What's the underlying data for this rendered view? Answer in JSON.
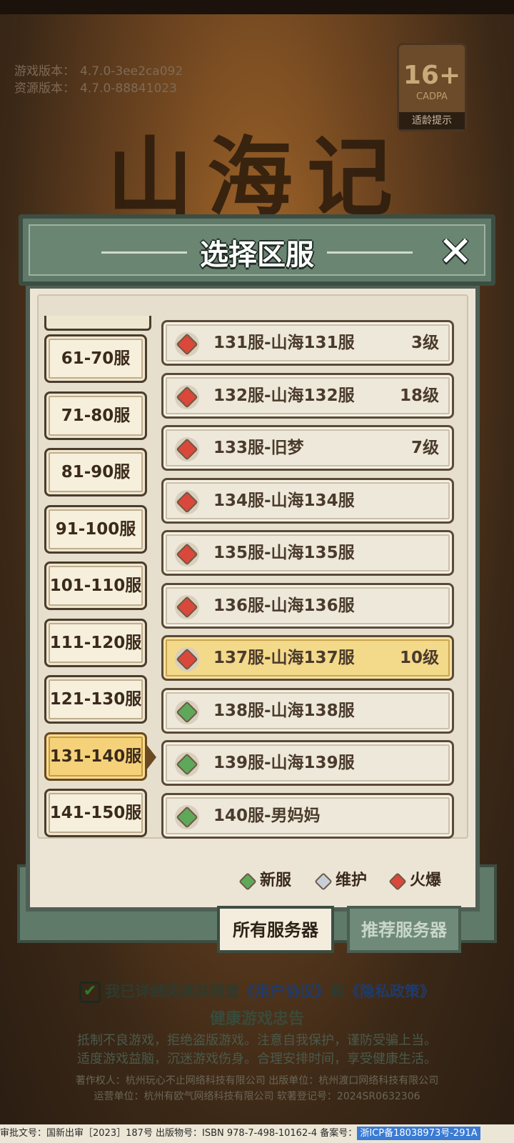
{
  "version": {
    "game_label": "游戏版本：",
    "game_value": "4.7.0-3ee2ca092",
    "res_label": "资源版本：",
    "res_value": "4.7.0-88841023"
  },
  "age_badge": {
    "number": "16+",
    "org": "CADPA",
    "tip": "适龄提示"
  },
  "logo_text": "山海记",
  "dialog": {
    "title": "选择区服",
    "close_icon": "close-x-icon"
  },
  "ranges": [
    "61-70服",
    "71-80服",
    "81-90服",
    "91-100服",
    "101-110服",
    "111-120服",
    "121-130服",
    "131-140服",
    "141-150服"
  ],
  "active_range_index": 7,
  "servers": [
    {
      "name": "131服-山海131服",
      "level": "3级",
      "status": "hot"
    },
    {
      "name": "132服-山海132服",
      "level": "18级",
      "status": "hot"
    },
    {
      "name": "133服-旧梦",
      "level": "7级",
      "status": "hot"
    },
    {
      "name": "134服-山海134服",
      "level": "",
      "status": "hot"
    },
    {
      "name": "135服-山海135服",
      "level": "",
      "status": "hot"
    },
    {
      "name": "136服-山海136服",
      "level": "",
      "status": "hot"
    },
    {
      "name": "137服-山海137服",
      "level": "10级",
      "status": "hot"
    },
    {
      "name": "138服-山海138服",
      "level": "",
      "status": "new"
    },
    {
      "name": "139服-山海139服",
      "level": "",
      "status": "new"
    },
    {
      "name": "140服-男妈妈",
      "level": "",
      "status": "new"
    }
  ],
  "selected_server_index": 6,
  "legend": {
    "new": "新服",
    "maintain": "维护",
    "hot": "火爆"
  },
  "colors": {
    "new": "#5fa85a",
    "maintain": "#c9cfd8",
    "hot": "#d9483a"
  },
  "tabs": {
    "all": "所有服务器",
    "recommended": "推荐服务器"
  },
  "agreement": {
    "prefix": "我已详细阅读并同意",
    "user": "《用户协议》",
    "and": "和",
    "privacy": "《隐私政策》"
  },
  "fcm": {
    "title": "健康游戏忠告",
    "line1": "抵制不良游戏，拒绝盗版游戏。注意自我保护，谨防受骗上当。",
    "line2": "适度游戏益脑，沉迷游戏伤身。合理安排时间，享受健康生活。"
  },
  "copyright": {
    "line1": "著作权人：杭州玩心不止网络科技有限公司  出版单位：杭州渡口网络科技有限公司",
    "line2": "运营单位：杭州有欧气网络科技有限公司  软著登记号：2024SR0632306"
  },
  "bottom": {
    "text": "审批文号：国新出审［2023］187号 出版物号：ISBN 978-7-498-10162-4 备案号：",
    "icp": "浙ICP备18038973号-291A"
  }
}
